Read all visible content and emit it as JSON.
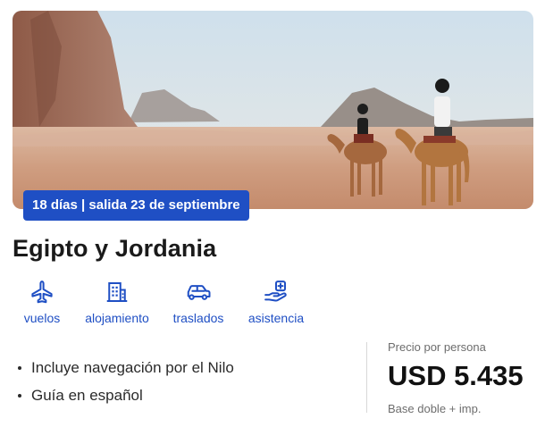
{
  "tour": {
    "badge": "18 días | salida 23 de septiembre",
    "title": "Egipto y Jordania",
    "features": [
      {
        "icon": "airplane-icon",
        "label": "vuelos"
      },
      {
        "icon": "building-icon",
        "label": "alojamiento"
      },
      {
        "icon": "car-icon",
        "label": "traslados"
      },
      {
        "icon": "hand-plus-icon",
        "label": "asistencia"
      }
    ],
    "highlights": [
      "Incluye navegación por el Nilo",
      "Guía en español"
    ]
  },
  "pricing": {
    "label": "Precio por persona",
    "amount": "USD 5.435",
    "note": "Base doble + imp."
  },
  "colors": {
    "accent": "#1f4fc4",
    "text": "#1a1a1a",
    "muted": "#6d6d6d"
  }
}
